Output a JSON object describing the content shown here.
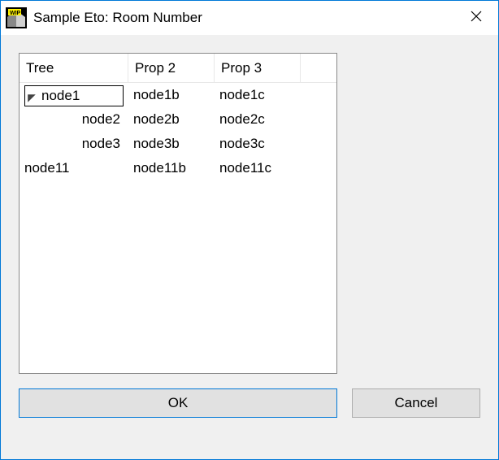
{
  "window": {
    "title": "Sample Eto: Room Number"
  },
  "tree": {
    "columns": [
      "Tree",
      "Prop 2",
      "Prop 3"
    ],
    "rows": [
      {
        "depth": 0,
        "expanded": true,
        "selected": true,
        "cells": [
          "node1",
          "node1b",
          "node1c"
        ]
      },
      {
        "depth": 1,
        "expanded": false,
        "selected": false,
        "cells": [
          "node2",
          "node2b",
          "node2c"
        ]
      },
      {
        "depth": 1,
        "expanded": false,
        "selected": false,
        "cells": [
          "node3",
          "node3b",
          "node3c"
        ]
      },
      {
        "depth": 0,
        "expanded": false,
        "selected": false,
        "cells": [
          "node11",
          "node11b",
          "node11c"
        ]
      }
    ]
  },
  "buttons": {
    "ok": "OK",
    "cancel": "Cancel"
  }
}
